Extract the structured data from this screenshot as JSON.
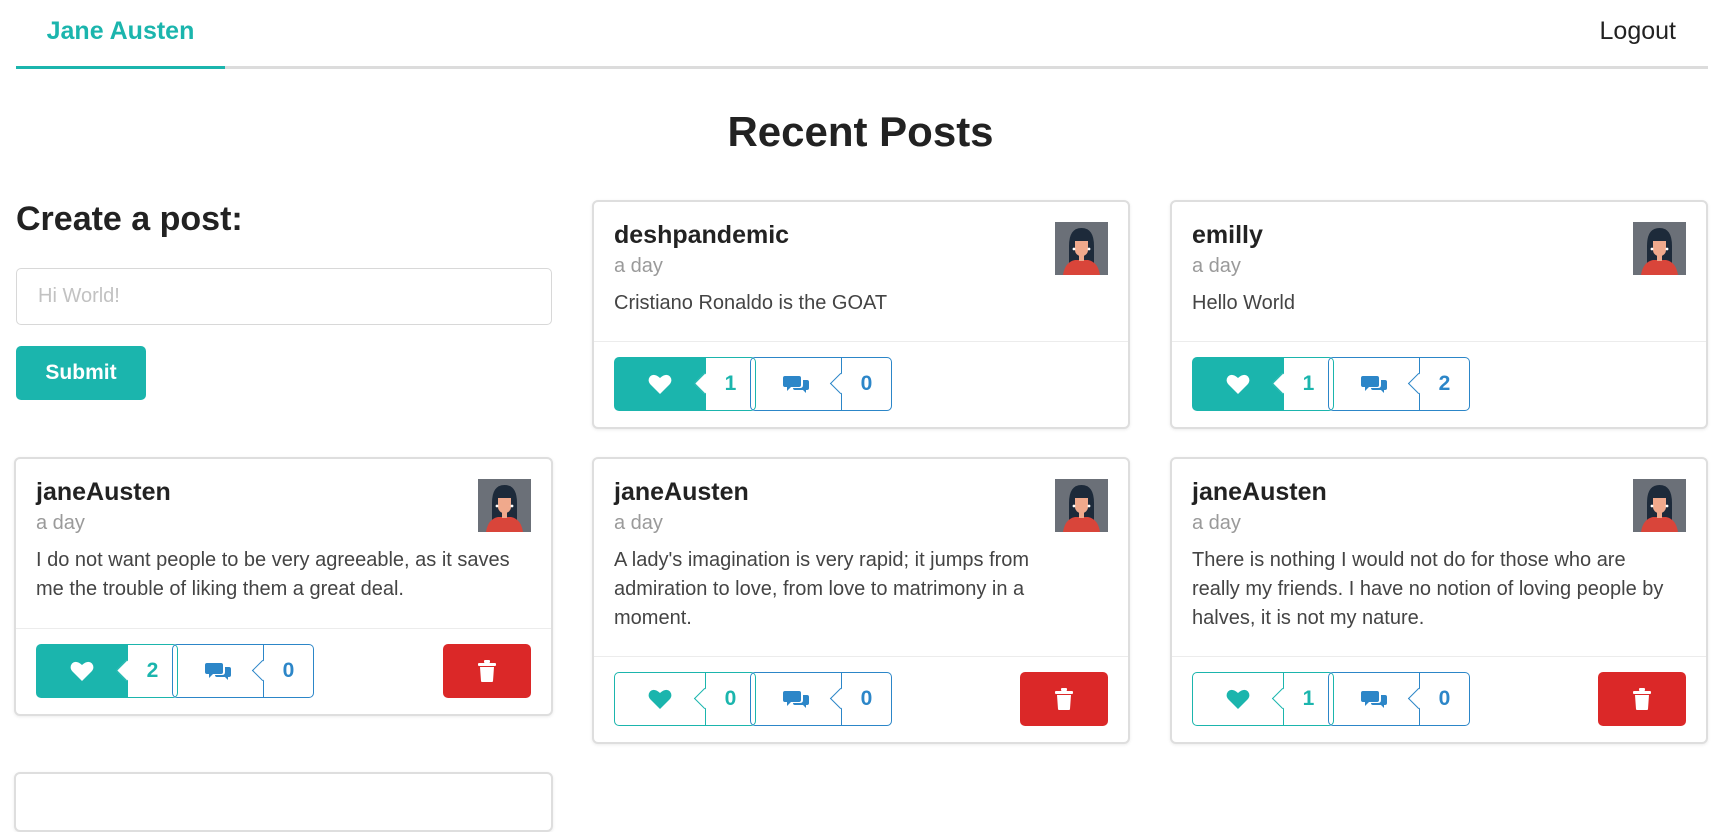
{
  "nav": {
    "brand": "Jane Austen",
    "logout": "Logout"
  },
  "page_title": "Recent Posts",
  "create": {
    "heading": "Create a post:",
    "placeholder": "Hi World!",
    "submit": "Submit"
  },
  "posts": [
    {
      "author": "deshpandemic",
      "time": "a day",
      "body": "Cristiano Ronaldo is the GOAT",
      "likes": "1",
      "comments": "0",
      "liked": true,
      "deletable": false
    },
    {
      "author": "emilly",
      "time": "a day",
      "body": "Hello World",
      "likes": "1",
      "comments": "2",
      "liked": true,
      "deletable": false
    },
    {
      "author": "janeAusten",
      "time": "a day",
      "body": "I do not want people to be very agreeable, as it saves me the trouble of liking them a great deal.",
      "likes": "2",
      "comments": "0",
      "liked": true,
      "deletable": true
    },
    {
      "author": "janeAusten",
      "time": "a day",
      "body": "A lady's imagination is very rapid; it jumps from admiration to love, from love to matrimony in a moment.",
      "likes": "0",
      "comments": "0",
      "liked": false,
      "deletable": true
    },
    {
      "author": "janeAusten",
      "time": "a day",
      "body": "There is nothing I would not do for those who are really my friends. I have no notion of loving people by halves, it is not my nature.",
      "likes": "1",
      "comments": "0",
      "liked": false,
      "deletable": true
    }
  ],
  "colors": {
    "accent": "#1bb5ad",
    "comment": "#2c86c8",
    "danger": "#db2828"
  }
}
